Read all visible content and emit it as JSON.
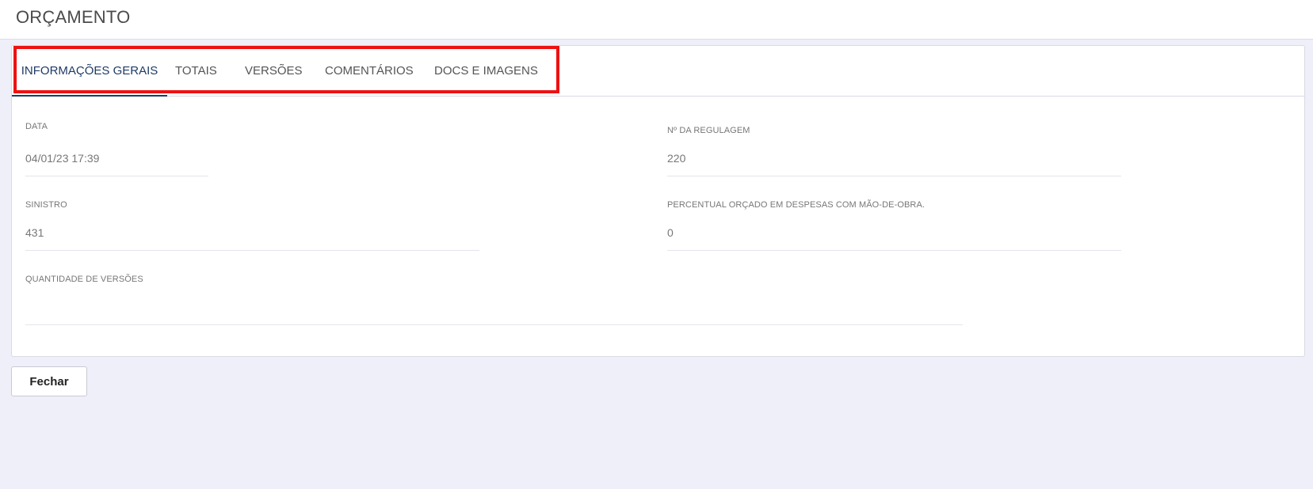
{
  "header": {
    "title": "ORÇAMENTO"
  },
  "tabs": [
    {
      "label": "INFORMAÇÕES GERAIS",
      "active": true
    },
    {
      "label": "TOTAIS",
      "active": false
    },
    {
      "label": "VERSÕES",
      "active": false
    },
    {
      "label": "COMENTÁRIOS",
      "active": false
    },
    {
      "label": "DOCS E IMAGENS",
      "active": false
    }
  ],
  "fields": {
    "data": {
      "label": "DATA",
      "value": "04/01/23 17:39"
    },
    "regulagem": {
      "label": "Nº DA REGULAGEM",
      "value": "220"
    },
    "sinistro": {
      "label": "SINISTRO",
      "value": "431"
    },
    "percentual": {
      "label": "PERCENTUAL ORÇADO EM DESPESAS COM MÃO-DE-OBRA.",
      "value": "0"
    },
    "quantidade": {
      "label": "QUANTIDADE DE VERSÕES",
      "value": ""
    }
  },
  "actions": {
    "close_label": "Fechar"
  },
  "colors": {
    "active_tab": "#1f3a66",
    "highlight": "#ee1111",
    "background": "#eeeff8"
  }
}
